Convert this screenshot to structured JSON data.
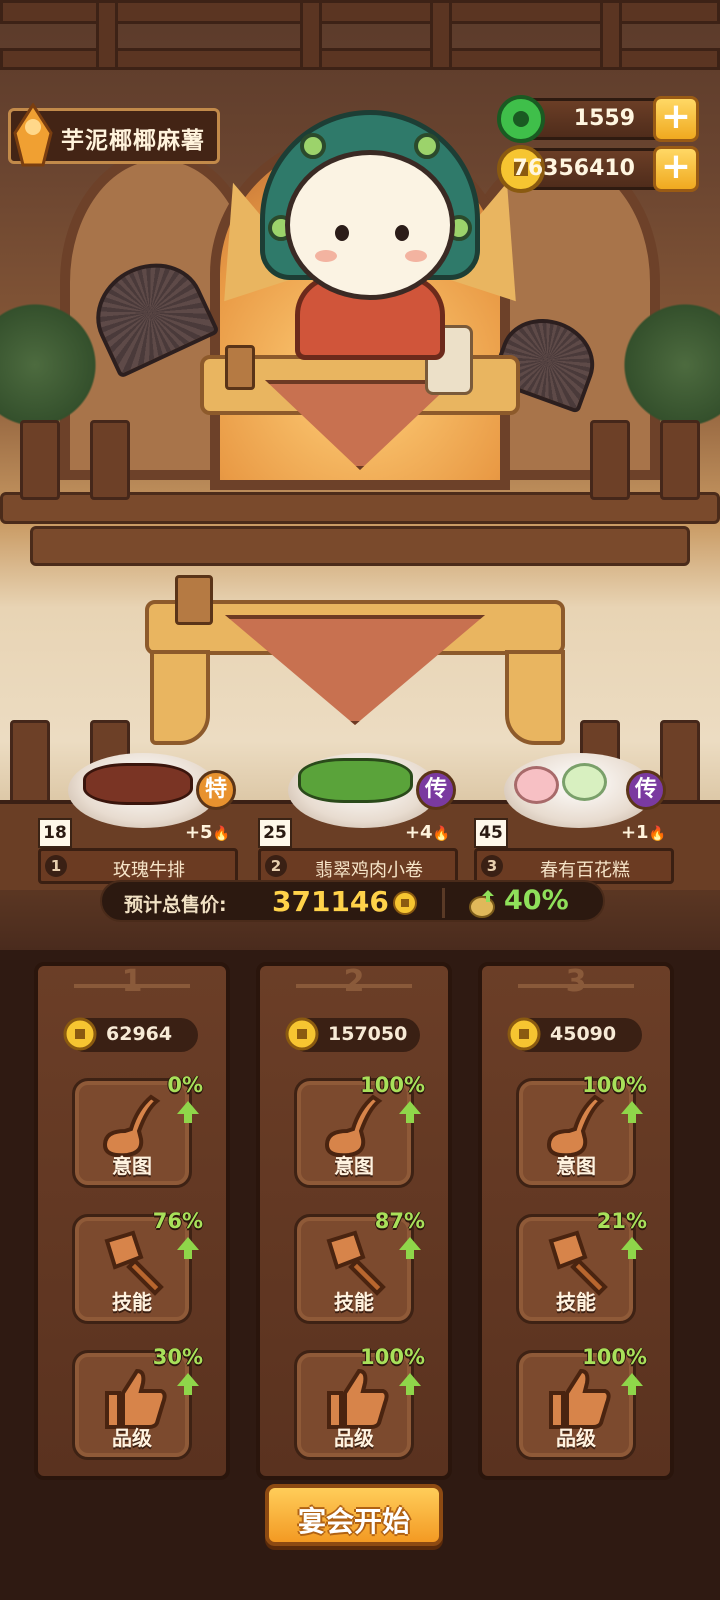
{
  "player": {
    "name": "芋泥椰椰麻薯",
    "avatar_icon": "chef-avatar-icon"
  },
  "resources": {
    "jade": {
      "value": "1559",
      "icon": "jade-coin-icon",
      "plus_icon": "plus-icon"
    },
    "coins": {
      "value": "76356410",
      "icon": "gold-coin-icon",
      "plus_icon": "plus-icon"
    }
  },
  "dishes": [
    {
      "index": "1",
      "name": "玫瑰牛排",
      "level": "18",
      "bonus": "+5",
      "badge": "特",
      "badge_color": "#e8922e"
    },
    {
      "index": "2",
      "name": "翡翠鸡肉小卷",
      "level": "25",
      "bonus": "+4",
      "badge": "传",
      "badge_color": "#7a3aa0"
    },
    {
      "index": "3",
      "name": "春有百花糕",
      "level": "45",
      "bonus": "+1",
      "badge": "传",
      "badge_color": "#7a3aa0"
    }
  ],
  "summary": {
    "label": "预计总售价:",
    "total": "371146",
    "bonus_pct": "40%"
  },
  "columns": [
    {
      "number": "1",
      "price": "62964",
      "stats": [
        {
          "label": "意图",
          "pct": "0%",
          "icon": "ladle-icon"
        },
        {
          "label": "技能",
          "pct": "76%",
          "icon": "cleaver-icon"
        },
        {
          "label": "品级",
          "pct": "30%",
          "icon": "thumbs-up-icon"
        }
      ]
    },
    {
      "number": "2",
      "price": "157050",
      "stats": [
        {
          "label": "意图",
          "pct": "100%",
          "icon": "ladle-icon"
        },
        {
          "label": "技能",
          "pct": "87%",
          "icon": "cleaver-icon"
        },
        {
          "label": "品级",
          "pct": "100%",
          "icon": "thumbs-up-icon"
        }
      ]
    },
    {
      "number": "3",
      "price": "45090",
      "stats": [
        {
          "label": "意图",
          "pct": "100%",
          "icon": "ladle-icon"
        },
        {
          "label": "技能",
          "pct": "21%",
          "icon": "cleaver-icon"
        },
        {
          "label": "品级",
          "pct": "100%",
          "icon": "thumbs-up-icon"
        }
      ]
    }
  ],
  "start_button": {
    "label": "宴会开始"
  },
  "colors": {
    "accent_gold": "#ffd24a",
    "bonus_green": "#8fe05a",
    "panel_brown": "#5a321f"
  }
}
